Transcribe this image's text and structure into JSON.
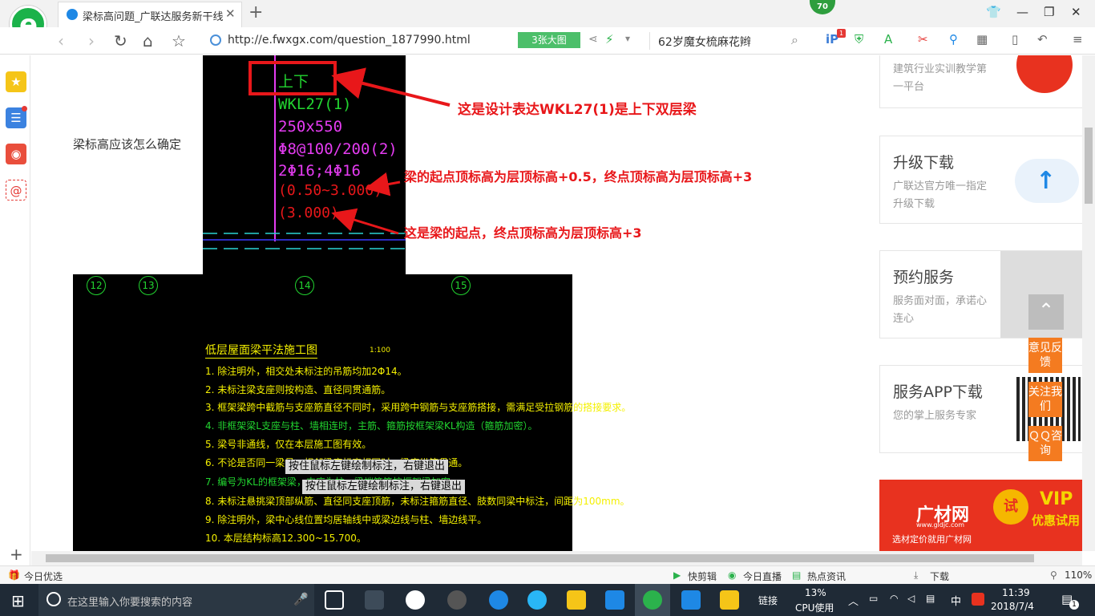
{
  "browser": {
    "tab_title": "梁标高问题_广联达服务新干线",
    "url": "http://e.fwxgx.com/question_1877990.html",
    "big_image_btn": "3张大图",
    "search_query": "62岁魔女梳麻花辫",
    "badge_count": "70",
    "ext_badge": "1"
  },
  "page": {
    "question_text": "梁标高应该怎么确定",
    "cad_top": {
      "line1": "上下",
      "line2": "WKL27(1)",
      "line3": "250x550",
      "line4": "Φ8@100/200(2)",
      "line5": "2Φ16;4Φ16",
      "line6": "(0.50~3.000)",
      "line7": "(3.000)"
    },
    "annotations": {
      "a1": "这是设计表达WKL27(1)是上下双层梁",
      "a2": "梁的起点顶标高为层顶标高+0.5，终点顶标高为层顶标高+3",
      "a3": "这是梁的起点，终点顶标高为层顶标高+3"
    },
    "cad_bottom": {
      "axes": [
        "12",
        "13",
        "14",
        "15"
      ],
      "title": "低层屋面梁平法施工图",
      "scale": "1:100",
      "notes": [
        "1. 除注明外，相交处未标注的吊筋均加2Φ14。",
        "2. 未标注梁支座则按构造、直径同贯通筋。",
        "3. 框架梁跨中截筋与支座筋直径不同时，采用跨中钢筋与支座筋搭接，需满足受拉钢筋的搭接要求。",
        "4. 非框架梁L支座与柱、墙相连时，主筋、箍筋按框架梁KL构造（箍筋加密）。",
        "5. 梁号非通线，仅在本层施工图有效。",
        "6. 不论是否同一梁号，相邻梁底标高相同时，梁底纵筋贯通。",
        "7. 编号为KL的框架梁，支座为柱，梁端箍筋按框架梁加密。",
        "8. 未标注悬挑梁顶部纵筋、直径同支座顶筋，未标注箍筋直径、肢数同梁中标注，间距为100mm。",
        "9. 除注明外，梁中心线位置均居轴线中或梁边线与柱、墙边线平。",
        "10. 本层结构标高12.300~15.700。"
      ],
      "tip1": "按住鼠标左键绘制标注，右键退出",
      "tip2": "按住鼠标左键绘制标注，右键退出"
    }
  },
  "sidebar": {
    "cards": [
      {
        "title": "",
        "desc": "建筑行业实训教学第一平台"
      },
      {
        "title": "升级下载",
        "desc": "广联达官方唯一指定升级下载"
      },
      {
        "title": "预约服务",
        "desc": "服务面对面，承诺心连心"
      },
      {
        "title": "服务APP下载",
        "desc": "您的掌上服务专家"
      }
    ],
    "float_buttons": [
      "意见反馈",
      "关注我们",
      "ＱＱ咨询"
    ],
    "ad": {
      "brand": "广材网",
      "domain": "www.gldjc.com",
      "tagline": "选材定价就用广材网",
      "try": "试",
      "vip": "VIP",
      "vip_sub": "优惠试用"
    }
  },
  "statusbar": {
    "left": "今日优选",
    "items": [
      "快剪辑",
      "今日直播",
      "热点资讯",
      "下载",
      "110%"
    ]
  },
  "taskbar": {
    "search_placeholder": "在这里输入你要搜索的内容",
    "link": "链接",
    "cpu_pct": "13%",
    "cpu_label": "CPU使用",
    "ime": "中",
    "time": "11:39",
    "date": "2018/7/4",
    "notify_count": "1"
  }
}
